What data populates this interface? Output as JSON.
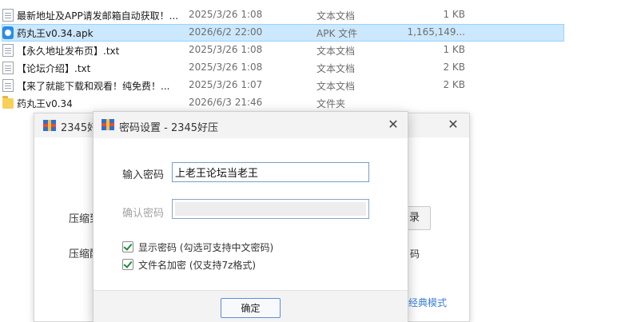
{
  "files": [
    {
      "name": "最新地址及APP请发邮箱自动获取！...",
      "date": "2025/3/26 1:08",
      "type": "文本文档",
      "size": "1 KB",
      "icon": "text-file-icon",
      "selected": false
    },
    {
      "name": "药丸王v0.34.apk",
      "date": "2026/6/2 22:00",
      "type": "APK 文件",
      "size": "1,165,149...",
      "icon": "apk-file-icon",
      "selected": true
    },
    {
      "name": "【永久地址发布页】.txt",
      "date": "2025/3/26 1:08",
      "type": "文本文档",
      "size": "1 KB",
      "icon": "text-file-icon",
      "selected": false
    },
    {
      "name": "【论坛介绍】.txt",
      "date": "2025/3/26 1:08",
      "type": "文本文档",
      "size": "2 KB",
      "icon": "text-file-icon",
      "selected": false
    },
    {
      "name": "【来了就能下载和观看！纯免费！...",
      "date": "2025/3/26 1:07",
      "type": "文本文档",
      "size": "2 KB",
      "icon": "text-file-icon",
      "selected": false
    },
    {
      "name": "药丸王v0.34",
      "date": "2026/6/3 21:46",
      "type": "文件夹",
      "size": "",
      "icon": "folder-icon",
      "selected": false
    }
  ],
  "bg_window": {
    "title": "2345好",
    "close": "✕",
    "label_1": "压缩到",
    "label_2": "压缩配",
    "button_right": "录",
    "label_right": "码",
    "link": "经典模式"
  },
  "dialog": {
    "title": "密码设置 - 2345好压",
    "close": "✕",
    "password_label": "输入密码",
    "password_value": "上老王论坛当老王",
    "confirm_label": "确认密码",
    "show_password_label": "显示密码 (勾选可支持中文密码)",
    "show_password_checked": true,
    "encrypt_names_label": "文件名加密 (仅支持7z格式)",
    "encrypt_names_checked": true,
    "ok_label": "确定"
  },
  "colors": {
    "selection": "#cce8ff",
    "accent": "#2a8de8",
    "check": "#1f8a3a",
    "link": "#3b7fd8"
  }
}
